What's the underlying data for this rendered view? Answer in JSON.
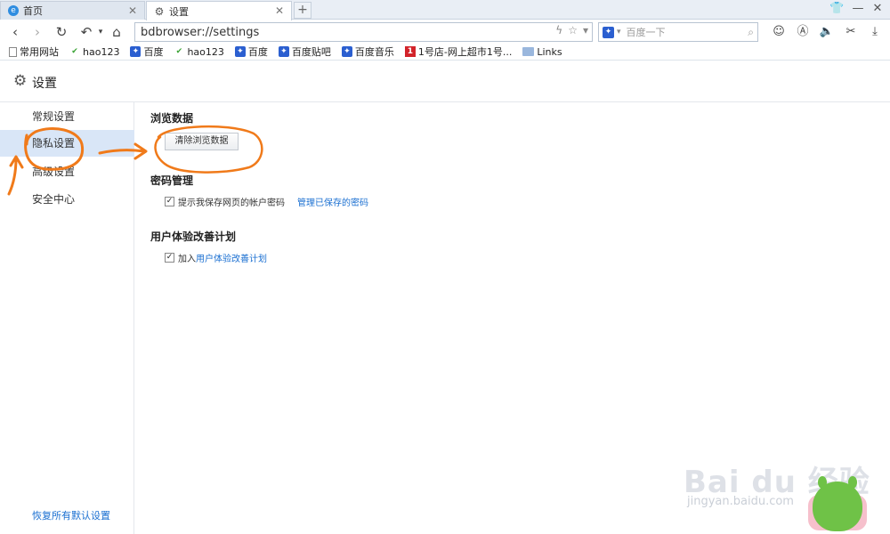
{
  "tabs": [
    {
      "label": "首页",
      "active": false
    },
    {
      "label": "设置",
      "active": true
    }
  ],
  "address": {
    "url": "bdbrowser://settings"
  },
  "search": {
    "placeholder": "百度一下"
  },
  "bookmarks": [
    {
      "label": "常用网站",
      "icon": "page-icon"
    },
    {
      "label": "hao123",
      "icon": "hao123-icon"
    },
    {
      "label": "百度",
      "icon": "baidu-paw-icon"
    },
    {
      "label": "hao123",
      "icon": "hao123-icon"
    },
    {
      "label": "百度",
      "icon": "baidu-paw-icon"
    },
    {
      "label": "百度贴吧",
      "icon": "baidu-paw-icon"
    },
    {
      "label": "百度音乐",
      "icon": "baidu-paw-icon"
    },
    {
      "label": "1号店-网上超市1号...",
      "icon": "yhd-icon"
    },
    {
      "label": "Links",
      "icon": "folder-icon"
    }
  ],
  "page": {
    "title": "设置"
  },
  "sidebar": {
    "items": [
      {
        "label": "常规设置",
        "active": false
      },
      {
        "label": "隐私设置",
        "active": true
      },
      {
        "label": "高级设置",
        "active": false
      },
      {
        "label": "安全中心",
        "active": false
      }
    ],
    "restore": "恢复所有默认设置"
  },
  "browsing": {
    "title": "浏览数据",
    "clear_button": "清除浏览数据"
  },
  "password": {
    "title": "密码管理",
    "prompt_label": "提示我保存网页的帐户密码",
    "manage_link": "管理已保存的密码",
    "checked": true
  },
  "ux": {
    "title": "用户体验改善计划",
    "join_prefix": "加入",
    "join_link": "用户体验改善计划",
    "checked": true
  },
  "watermark": {
    "brand": "Bai du 经验",
    "sub": "jingyan.baidu.com"
  },
  "colors": {
    "accent": "#1a6fd1",
    "annotation": "#f07a1a",
    "active_bg": "#d9e6f7"
  }
}
